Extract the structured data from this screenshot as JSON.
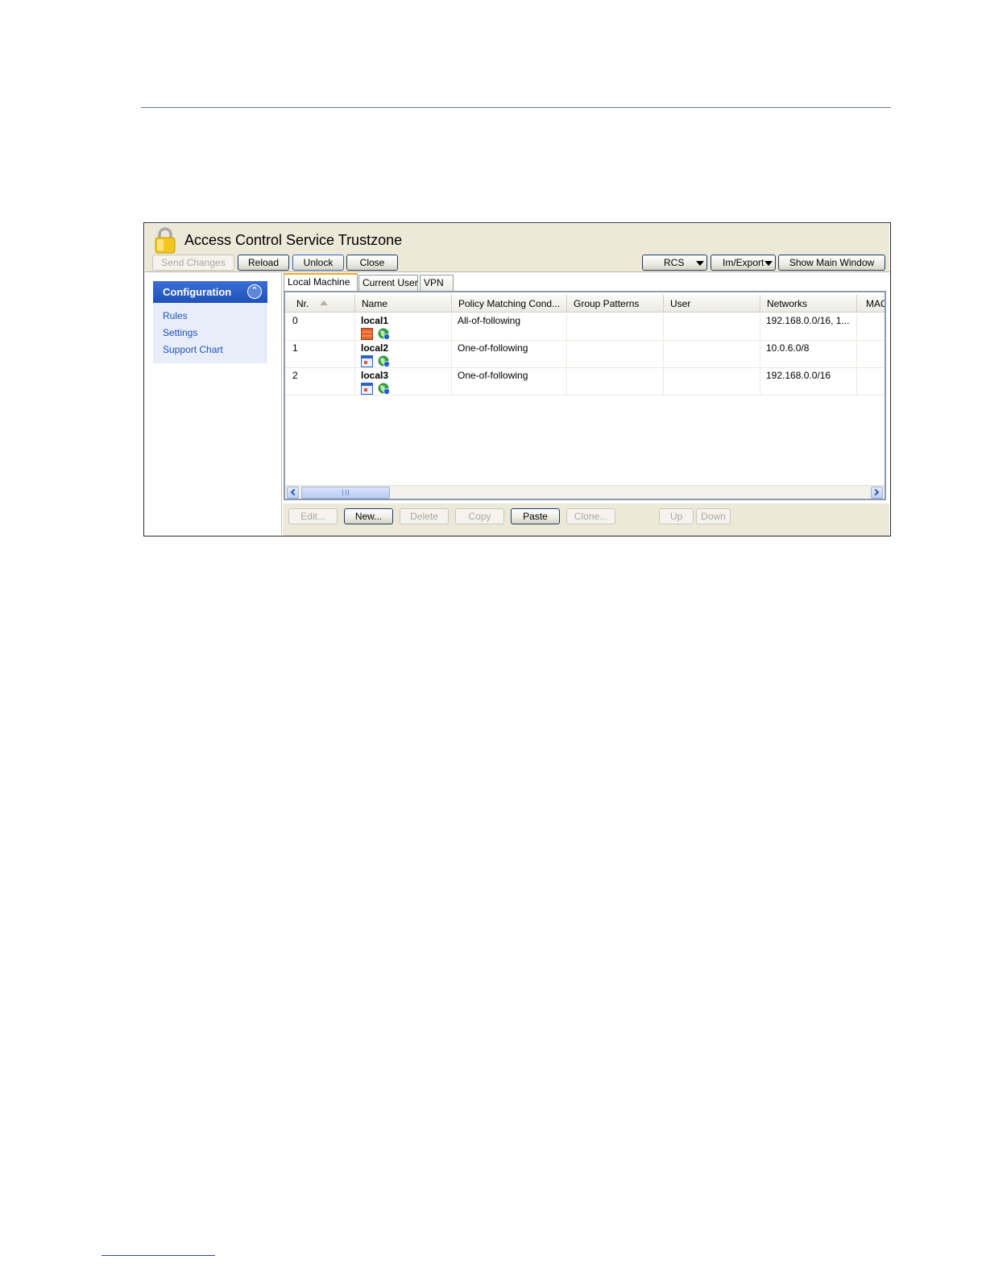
{
  "window": {
    "title": "Access Control Service Trustzone"
  },
  "toolbar": {
    "send_changes": "Send Changes",
    "reload": "Reload",
    "unlock": "Unlock",
    "close": "Close",
    "rcs": "RCS",
    "im_export": "Im/Export",
    "show_main_window": "Show Main Window"
  },
  "sidebar": {
    "header": "Configuration",
    "items": [
      {
        "label": "Rules"
      },
      {
        "label": "Settings"
      },
      {
        "label": "Support Chart"
      }
    ]
  },
  "tabs": [
    {
      "label": "Local Machine",
      "active": true
    },
    {
      "label": "Current User",
      "active": false
    },
    {
      "label": "VPN",
      "active": false
    }
  ],
  "table": {
    "columns": [
      "Nr.",
      "Name",
      "Policy Matching Cond...",
      "Group Patterns",
      "User",
      "Networks",
      "MAC"
    ],
    "rows": [
      {
        "nr": "0",
        "name": "local1",
        "policy": "All-of-following",
        "group": "",
        "user": "",
        "networks": "192.168.0.0/16, 1..."
      },
      {
        "nr": "1",
        "name": "local2",
        "policy": "One-of-following",
        "group": "",
        "user": "",
        "networks": "10.0.6.0/8"
      },
      {
        "nr": "2",
        "name": "local3",
        "policy": "One-of-following",
        "group": "",
        "user": "",
        "networks": "192.168.0.0/16"
      }
    ]
  },
  "actions": {
    "edit": "Edit...",
    "new": "New...",
    "delete": "Delete",
    "copy": "Copy",
    "paste": "Paste",
    "clone": "Clone...",
    "up": "Up",
    "down": "Down"
  },
  "icons": {
    "lock": "padlock-icon",
    "collapse": "collapse-up-icon",
    "rule_block": "rule-block-icon",
    "rule_window": "rule-window-icon",
    "network": "network-globe-icon"
  },
  "colors": {
    "accent": "#2458c3",
    "title_bar": "#ece9d8",
    "sidebar_panel": "#e8eef9",
    "active_tab": "#f5a623"
  }
}
